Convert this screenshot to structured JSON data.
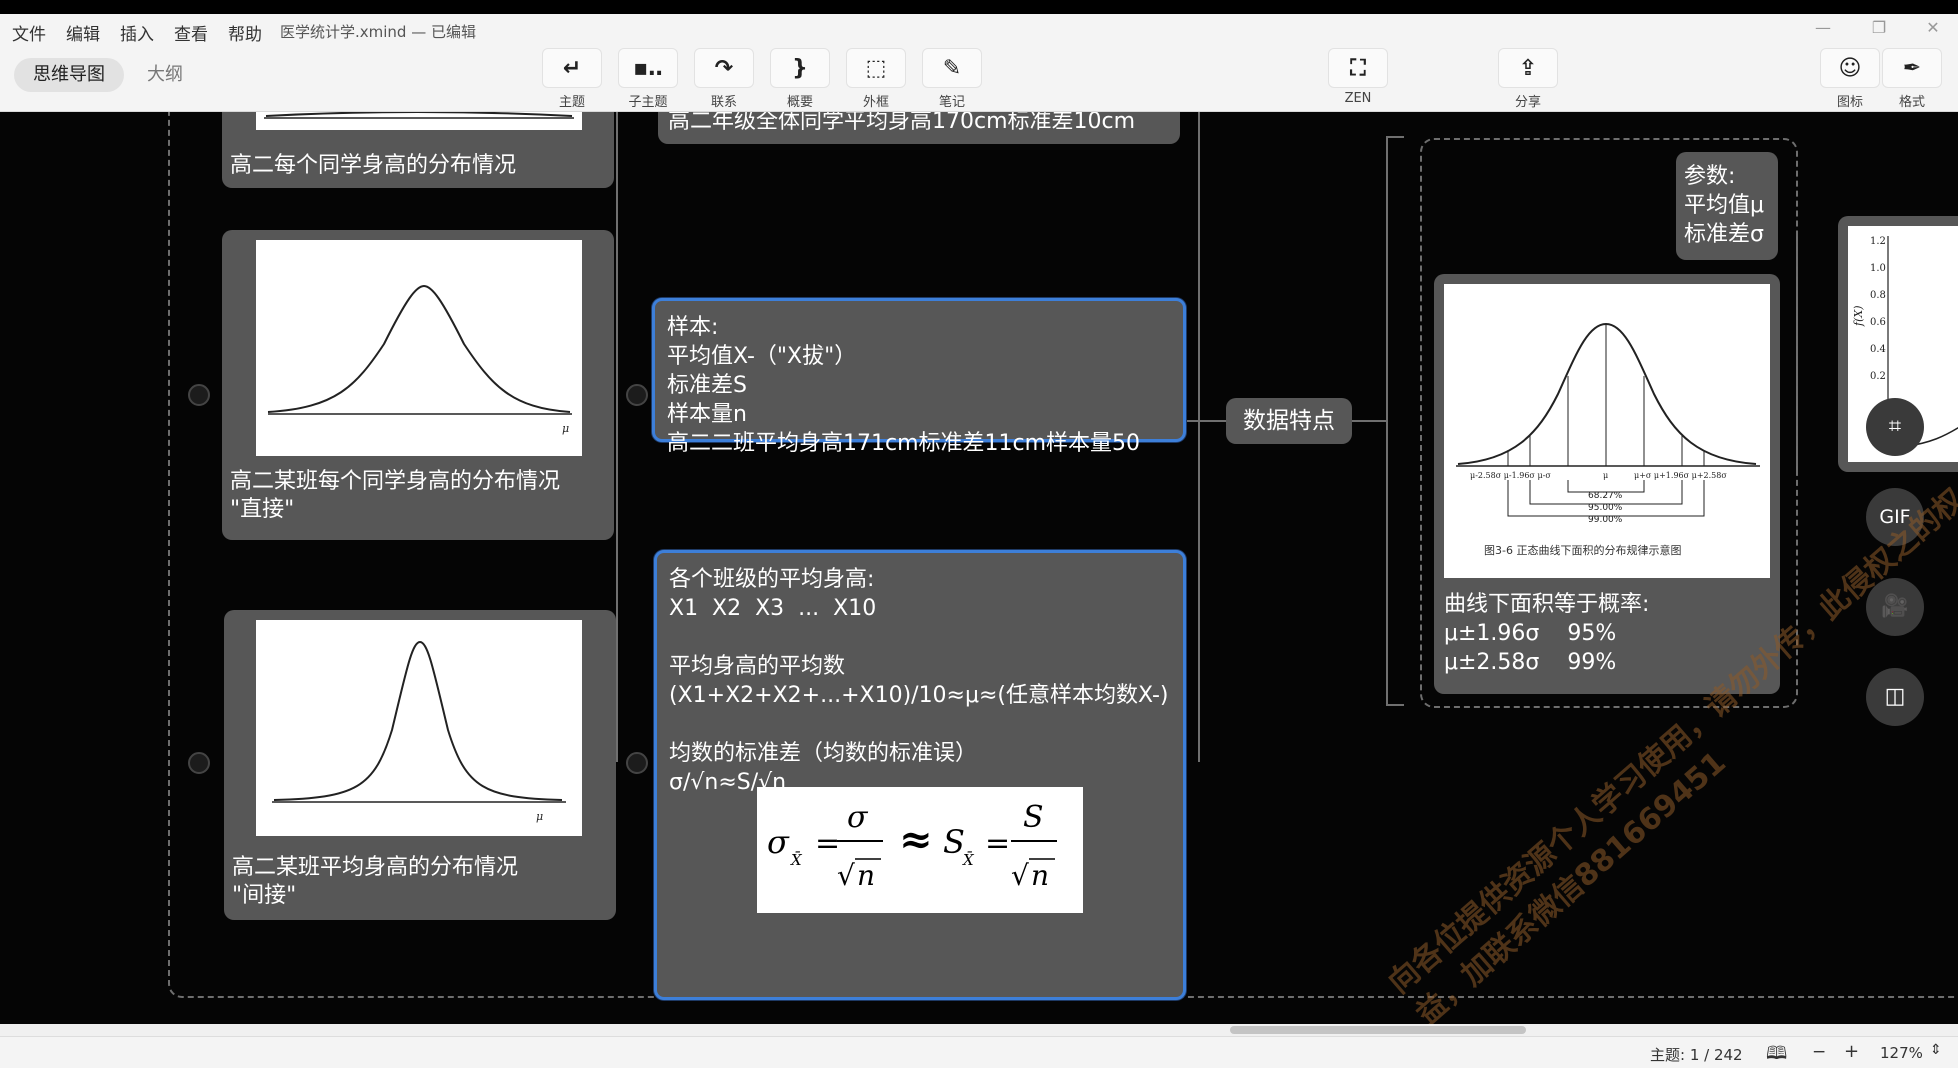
{
  "menu": [
    "文件",
    "编辑",
    "插入",
    "查看",
    "帮助"
  ],
  "document": {
    "title": "医学统计学.xmind — 已编辑"
  },
  "window_controls": [
    "minimize-icon",
    "restore-icon",
    "close-icon"
  ],
  "mode_tabs": [
    {
      "label": "思维导图",
      "active": true
    },
    {
      "label": "大纲",
      "active": false
    }
  ],
  "tools": [
    {
      "label": "主题",
      "icon": "↵"
    },
    {
      "label": "子主题",
      "icon": "▪‥"
    },
    {
      "label": "联系",
      "icon": "↷"
    },
    {
      "label": "概要",
      "icon": "}"
    },
    {
      "label": "外框",
      "icon": "⬚"
    },
    {
      "label": "笔记",
      "icon": "✎"
    },
    {
      "label": "ZEN",
      "icon": "⛶"
    },
    {
      "label": "分享",
      "icon": "⇪"
    }
  ],
  "right_tools": [
    {
      "label": "图标",
      "icon": "☺"
    },
    {
      "label": "格式",
      "icon": "✒"
    }
  ],
  "nodes": {
    "top_caption": "高二每个同学身高的分布情况",
    "top_middle": "高二年级全体同学平均身高170cm标准差10cm",
    "class_dist": {
      "caption": "高二某班每个同学身高的分布情况\n\"直接\""
    },
    "class_mean_dist": {
      "caption": "高二某班平均身高的分布情况\n\"间接\""
    },
    "sample": {
      "text": "样本:\n平均值X-（\"X拔\"）\n标准差S\n样本量n\n高二二班平均身高171cm标准差11cm样本量50"
    },
    "class_means": {
      "text": "各个班级的平均身高:\nX1  X2  X3  ...  X10\n\n平均身高的平均数\n(X1+X2+X2+...+X10)/10≈μ≈(任意样本均数X-)\n\n均数的标准差（均数的标准误）\nσ/√n≈S/√n"
    },
    "data_features": "数据特点",
    "params": "参数:\n平均值μ\n标准差σ",
    "probability": {
      "text": "曲线下面积等于概率:\nμ±1.96σ    95%\nμ±2.58σ    99%"
    }
  },
  "formula": {
    "sigma": "σ",
    "sub": "X̄",
    "n": "n",
    "approx": "≈",
    "s": "S"
  },
  "normal_chart": {
    "pct_labels": [
      "68.27%",
      "95.00%",
      "99.00%"
    ],
    "caption": "图3-6  正态曲线下面积的分布规律示意图",
    "x_labels": [
      "μ-2.58σ μ-1.96σ μ-σ",
      "μ",
      "μ+σ  μ+1.96σ μ+2.58σ"
    ],
    "mu": "μ"
  },
  "right_chart": {
    "ylabel": "f(X)",
    "yticks": [
      "1.2",
      "1.0",
      "0.8",
      "0.6",
      "0.4",
      "0.2"
    ]
  },
  "fab_buttons": [
    {
      "icon": "crop-icon",
      "label": "⌗"
    },
    {
      "icon": "gif-icon",
      "label": "GIF"
    },
    {
      "icon": "record-icon",
      "label": "🎥"
    },
    {
      "icon": "layout-icon",
      "label": "◫"
    }
  ],
  "watermark": "向各位提供资源个人学习使用，请勿外传，此侵权之的权益，加联系微信881669451",
  "status": {
    "topic_count": "主题: 1 / 242",
    "zoom": "127%"
  }
}
